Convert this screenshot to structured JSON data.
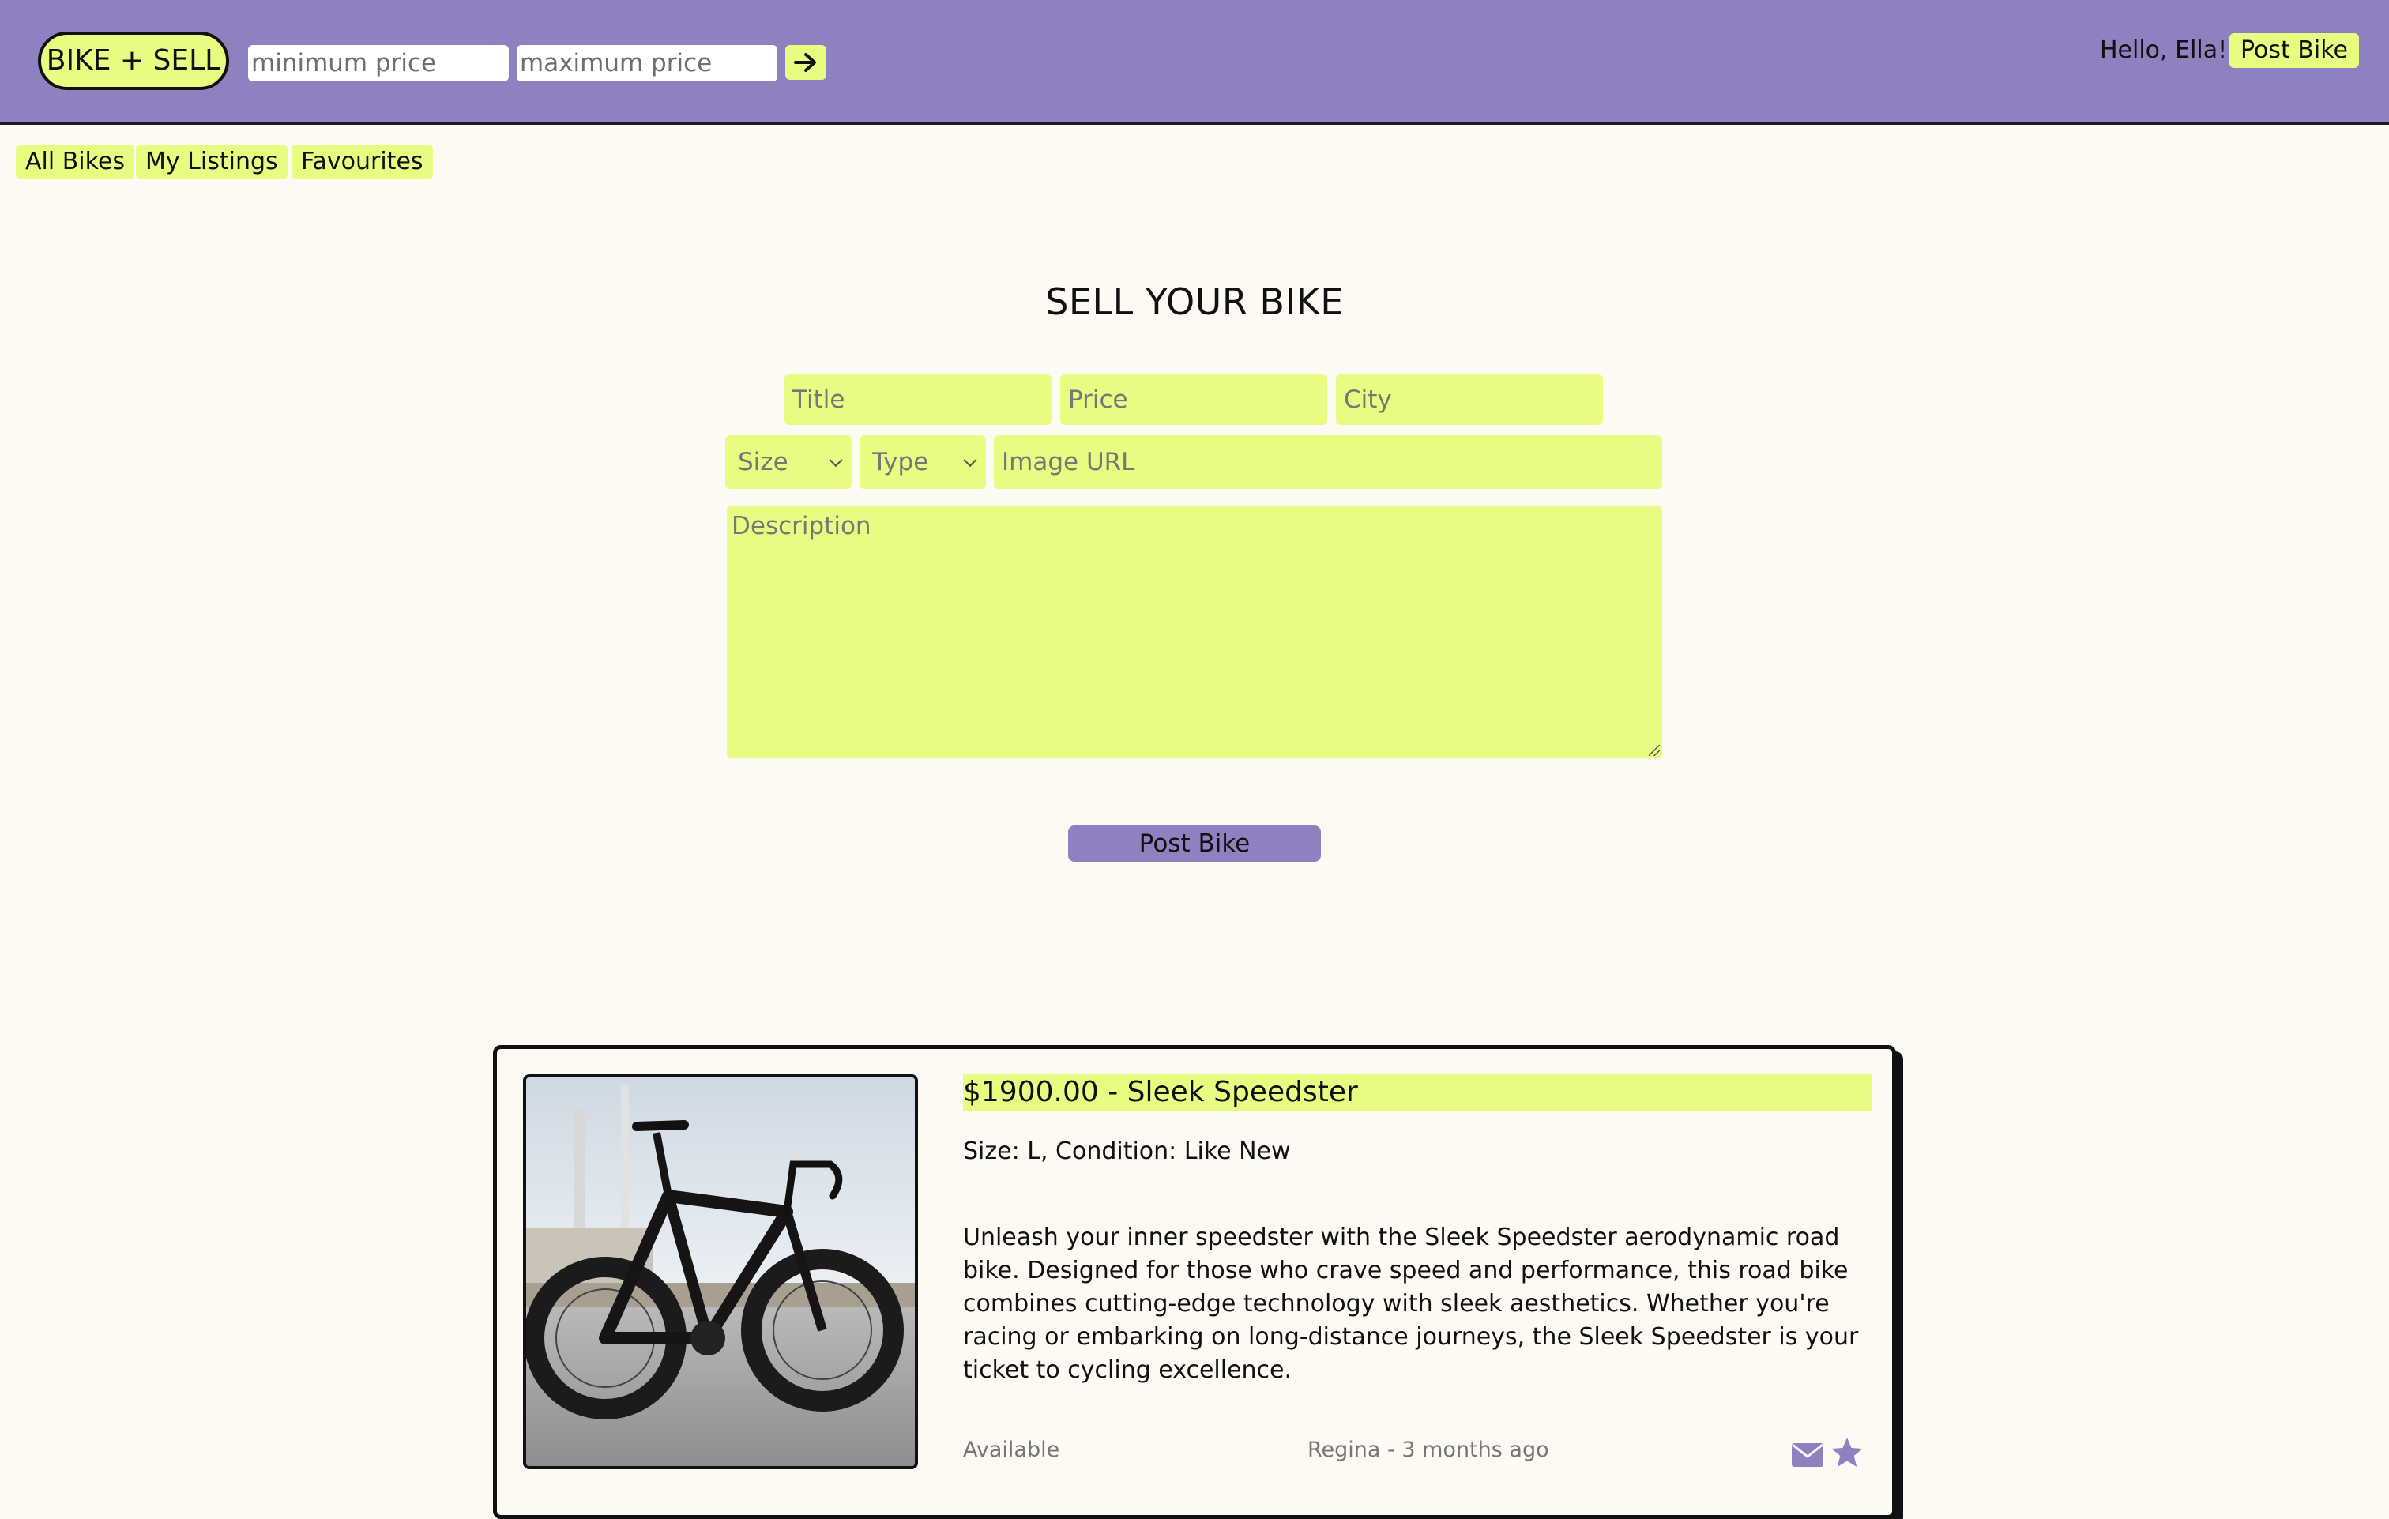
{
  "brand": {
    "logo_text": "BIKE + SELL"
  },
  "filters": {
    "min_placeholder": "minimum price",
    "max_placeholder": "maximum price",
    "submit_icon": "arrow-right-icon"
  },
  "user": {
    "greeting": "Hello, Ella!",
    "post_button": "Post Bike"
  },
  "nav": {
    "items": [
      {
        "label": "All Bikes"
      },
      {
        "label": "My Listings"
      },
      {
        "label": "Favourites"
      }
    ]
  },
  "form": {
    "heading": "SELL YOUR BIKE",
    "title_placeholder": "Title",
    "price_placeholder": "Price",
    "city_placeholder": "City",
    "size_label": "Size",
    "type_label": "Type",
    "image_placeholder": "Image URL",
    "description_placeholder": "Description",
    "submit_label": "Post Bike"
  },
  "listing": {
    "title": "$1900.00 - Sleek Speedster",
    "specs": "Size: L, Condition: Like New",
    "description": "Unleash your inner speedster with the Sleek Speedster aerodynamic road bike. Designed for those who crave speed and performance, this road bike combines cutting-edge technology with sleek aesthetics. Whether you're racing or embarking on long-distance journeys, the Sleek Speedster is your ticket to cycling excellence.",
    "status": "Available",
    "location_time": "Regina - 3 months ago",
    "icons": [
      "envelope-icon",
      "star-icon"
    ]
  },
  "colors": {
    "accent_purple": "#8f80c0",
    "accent_lime": "#e9fc82",
    "background": "#fcfaf3"
  }
}
